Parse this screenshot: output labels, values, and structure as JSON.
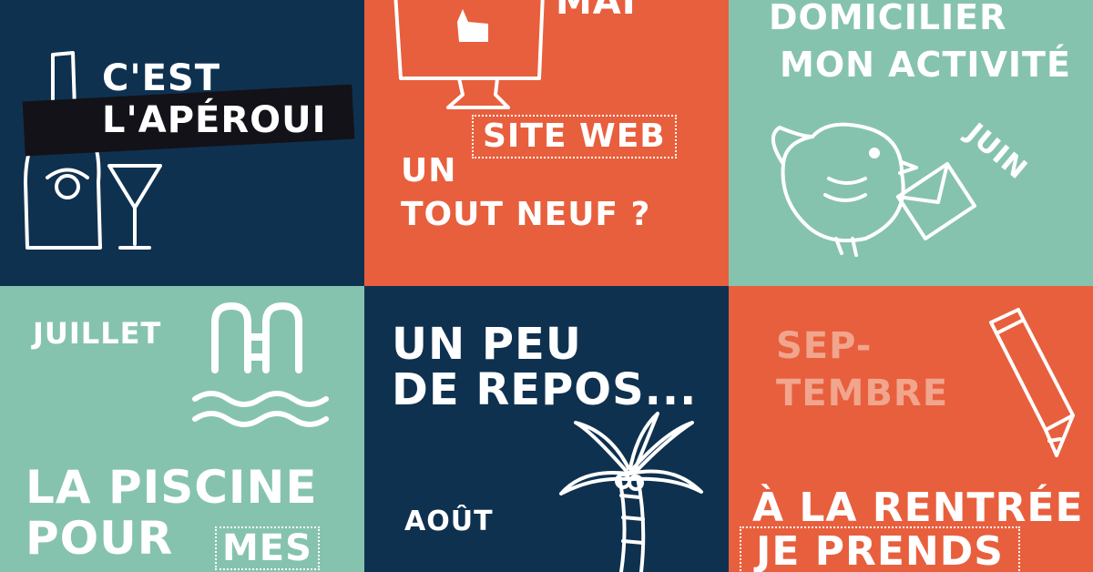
{
  "colors": {
    "navy": "#0f3150",
    "orange": "#e85f3d",
    "teal": "#86c3ae",
    "salmon": "#f1a58d",
    "white": "#ffffff"
  },
  "tiles": [
    {
      "month": "",
      "lines": [
        "C'EST",
        "L'APÉROUI"
      ],
      "icons": [
        "wine-bottle-icon",
        "cocktail-glass-icon"
      ]
    },
    {
      "month": "MAI",
      "lines": [
        "UN",
        "SITE WEB",
        "TOUT NEUF ?"
      ],
      "icons": [
        "computer-thumbs-up-icon"
      ]
    },
    {
      "month": "JUIN",
      "lines": [
        "DOMICILIER",
        "MON ACTIVITÉ"
      ],
      "icons": [
        "bird-with-letter-icon"
      ]
    },
    {
      "month": "JUILLET",
      "lines": [
        "LA PISCINE",
        "POUR",
        "MES"
      ],
      "icons": [
        "pool-ladder-icon",
        "waves-icon"
      ]
    },
    {
      "month": "AOÛT",
      "lines": [
        "UN PEU",
        "DE REPOS..."
      ],
      "icons": [
        "palm-tree-icon"
      ]
    },
    {
      "month": "SEP-\nTEMBRE",
      "month_lines": [
        "SEP-",
        "TEMBRE"
      ],
      "lines": [
        "À LA RENTRÉE",
        "JE PRENDS"
      ],
      "icons": [
        "pencil-icon"
      ]
    }
  ]
}
